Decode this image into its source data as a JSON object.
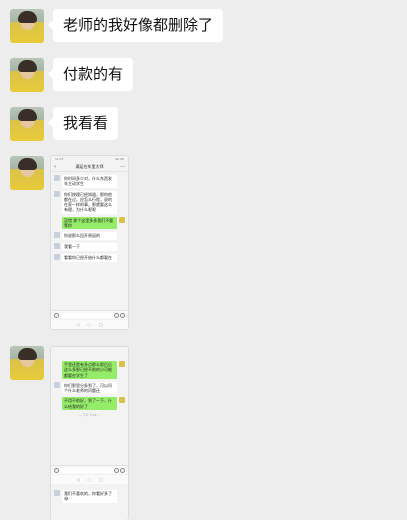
{
  "messages": [
    {
      "type": "text",
      "text": "老师的我好像都删除了"
    },
    {
      "type": "text",
      "text": "付款的有"
    },
    {
      "type": "text",
      "text": "我看看"
    }
  ],
  "screenshot_1": {
    "title": "满足在车里大师",
    "status_left": "11:27",
    "status_right": "4G 96",
    "msgs": [
      {
        "side": "l",
        "text": "你时间多少对，什么东西发车主动学生"
      },
      {
        "side": "l",
        "text": "你们按理已经知道，那你他都在过，应怎么行程，说的在家一样的事，那就要这么有理，为什么呢呢"
      },
      {
        "side": "r",
        "text": "没错 那个这里多多我们不要等你"
      },
      {
        "side": "l",
        "text": "你说那么回开原因的"
      },
      {
        "side": "l",
        "text": "我看一下"
      },
      {
        "side": "l",
        "text": "看看你已经开始什么都要在"
      }
    ],
    "nav": [
      "◁",
      "○",
      "□"
    ]
  },
  "screenshot_2": {
    "msgs": [
      {
        "side": "r",
        "text": "手里还是有多点那么那后后这么多那已经不前的小可能都要在学生了"
      },
      {
        "side": "l",
        "text": "你们那里分条到了，可以问个什么老师的问题还"
      },
      {
        "side": "r",
        "text": "不用不前好，到了一下，什么给我的好了"
      },
      {
        "side": "l",
        "text": "我们不喜欢的，你看好多了😂"
      }
    ],
    "time": "— 下午 2:18 —",
    "nav": [
      "◁",
      "○",
      "□"
    ]
  }
}
